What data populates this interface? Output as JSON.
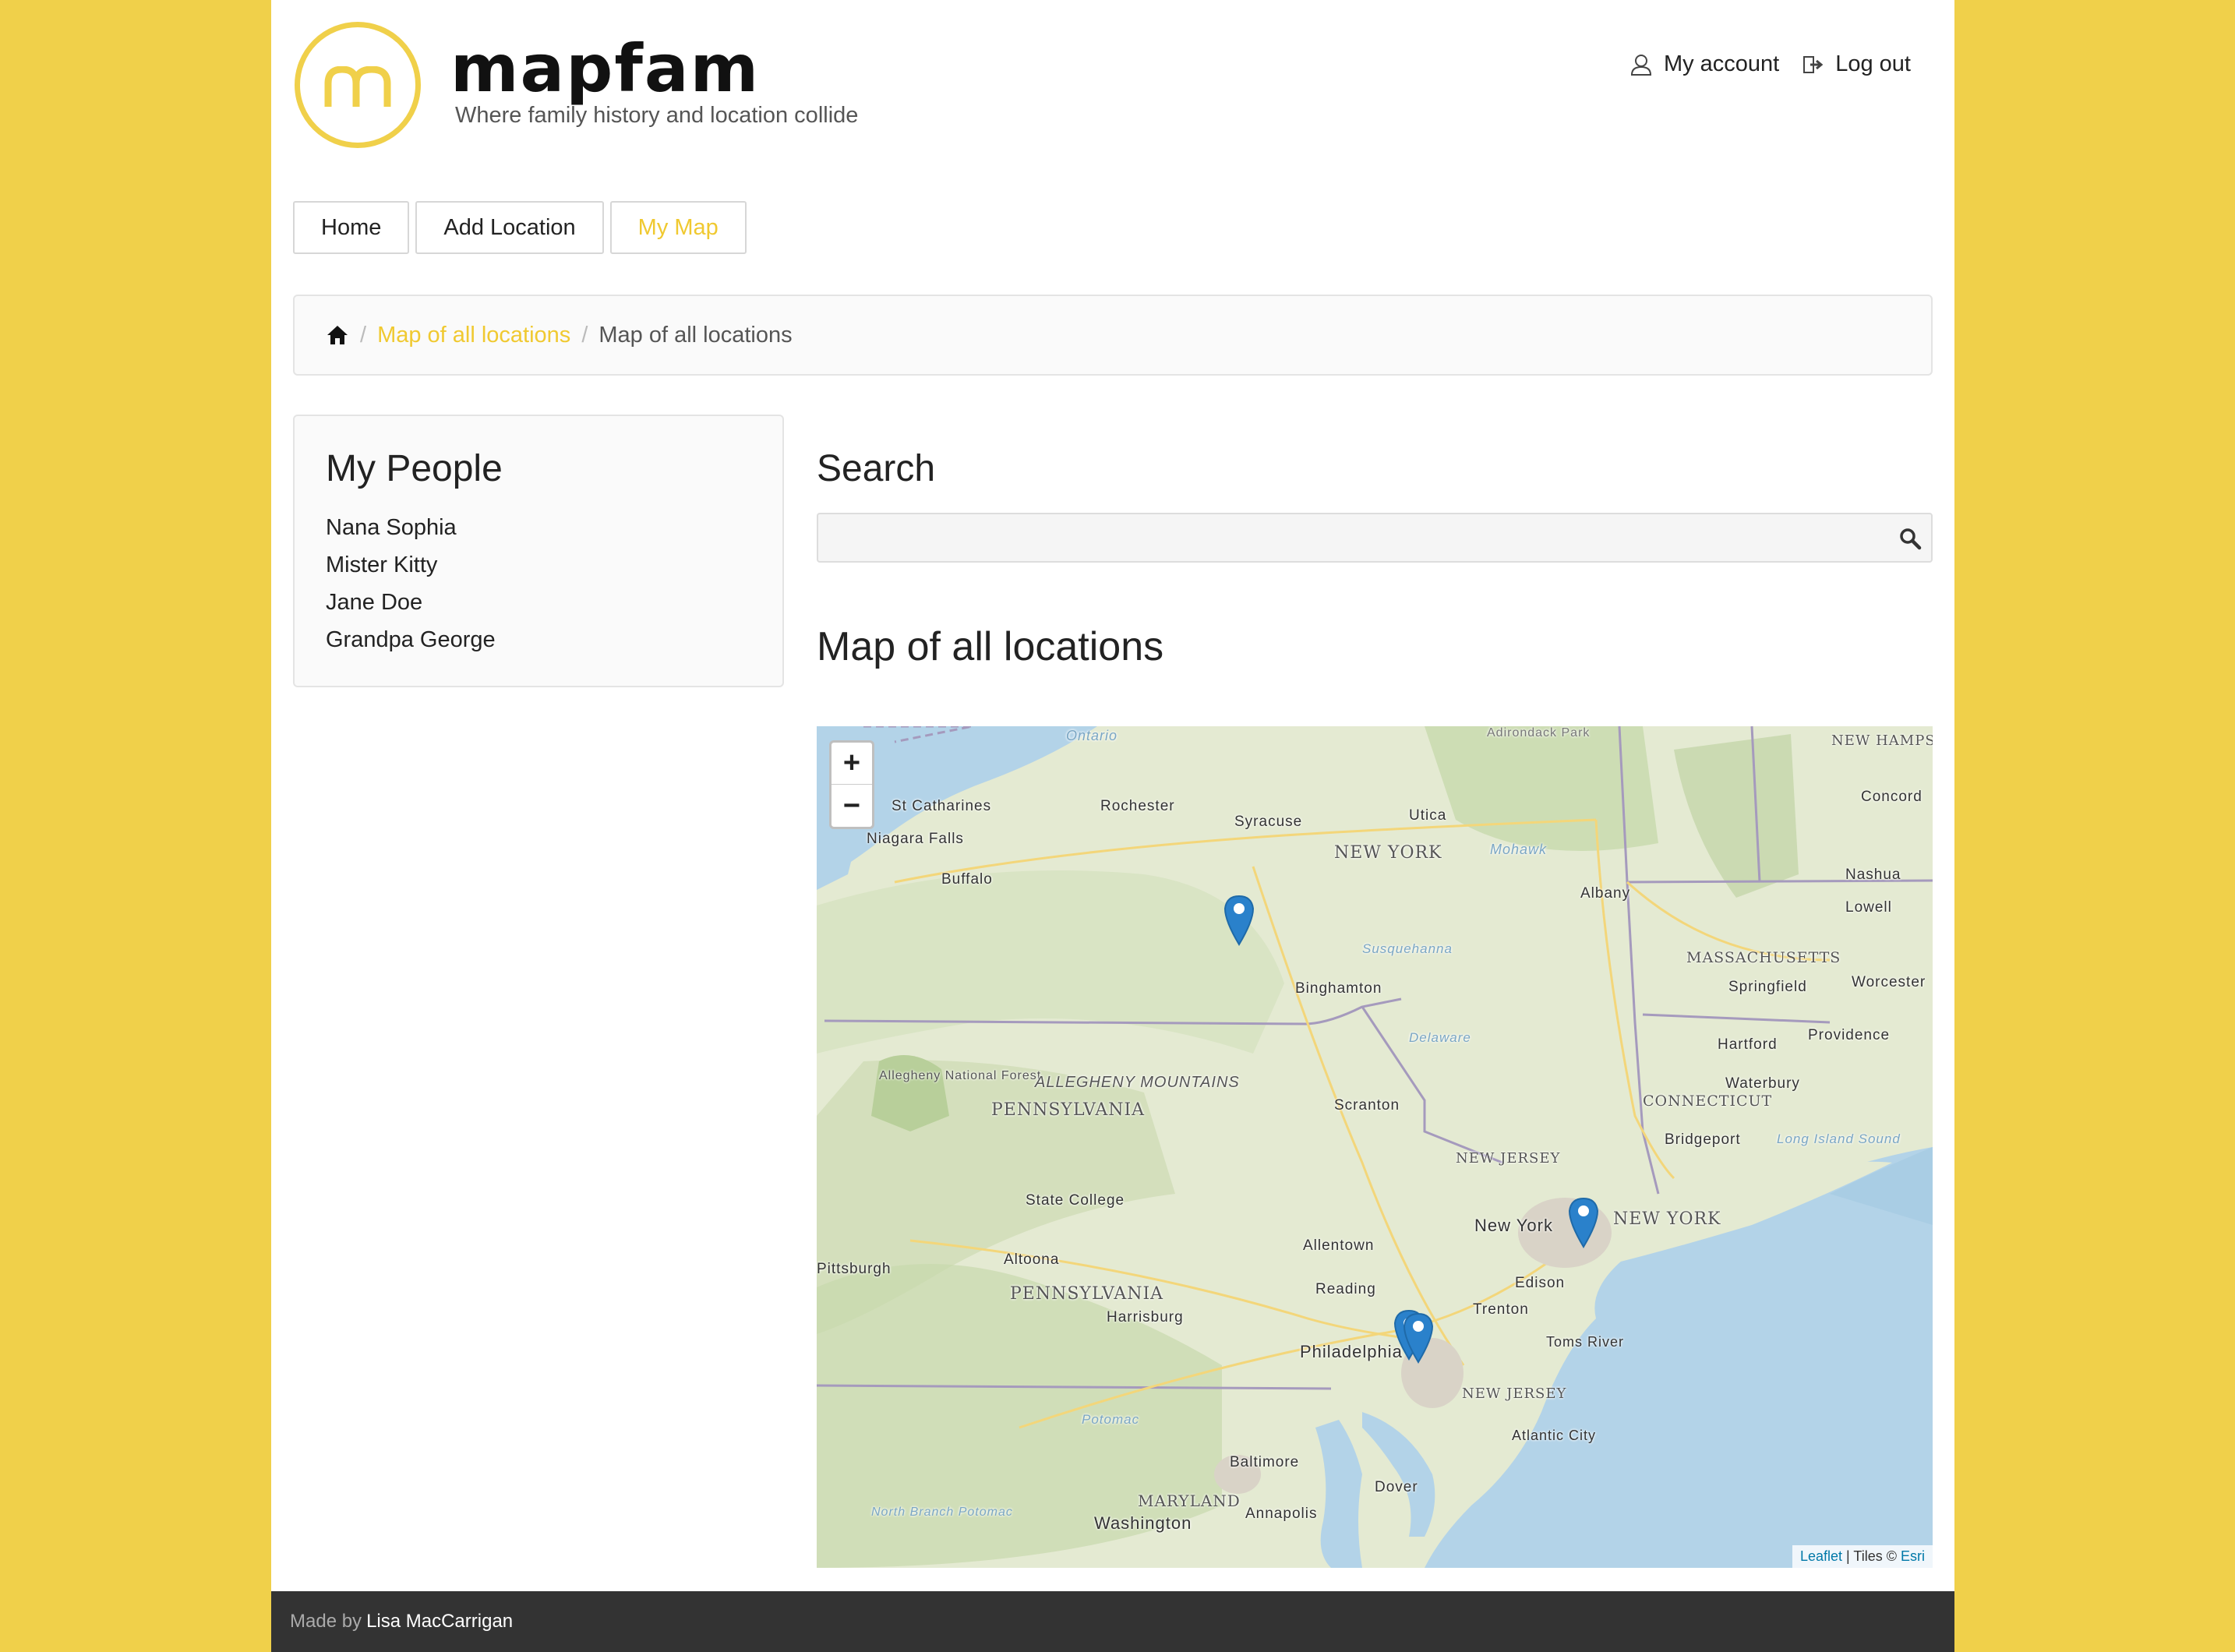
{
  "brand": {
    "name": "mapfam",
    "tagline": "Where family history and location collide",
    "accent": "#f0d04a"
  },
  "account": {
    "my_account": "My account",
    "log_out": "Log out"
  },
  "nav": {
    "home": "Home",
    "add_location": "Add Location",
    "my_map": "My Map",
    "active": "My Map"
  },
  "breadcrumb": {
    "home_icon": "home-icon",
    "link": "Map of all locations",
    "current": "Map of all locations"
  },
  "sidebar": {
    "title": "My People",
    "people": [
      "Nana Sophia",
      "Mister Kitty",
      "Jane Doe",
      "Grandpa George"
    ]
  },
  "search": {
    "title": "Search",
    "value": "",
    "placeholder": ""
  },
  "map": {
    "title": "Map of all locations",
    "zoom_in": "+",
    "zoom_out": "−",
    "attribution_leaflet": "Leaflet",
    "attribution_sep": " | Tiles © ",
    "attribution_esri": "Esri",
    "labels": {
      "ontario": "Ontario",
      "st_catharines": "St Catharines",
      "niagara_falls": "Niagara Falls",
      "buffalo": "Buffalo",
      "rochester": "Rochester",
      "syracuse": "Syracuse",
      "utica": "Utica",
      "new_york_state": "NEW YORK",
      "mohawk": "Mohawk",
      "albany": "Albany",
      "adirondack": "Adirondack Park",
      "new_hampshire": "NEW HAMPSHIRE",
      "concord": "Concord",
      "nashua": "Nashua",
      "lowell": "Lowell",
      "massachusetts": "MASSACHUSETTS",
      "springfield": "Springfield",
      "worcester": "Worcester",
      "providence": "Providence",
      "hartford": "Hartford",
      "waterbury": "Waterbury",
      "connecticut": "CONNECTICUT",
      "bridgeport": "Bridgeport",
      "long_island_sound": "Long Island Sound",
      "binghamton": "Binghamton",
      "susquehanna": "Susquehanna",
      "delaware": "Delaware",
      "allegheny_forest": "Allegheny National Forest",
      "allegheny_mountains": "ALLEGHENY MOUNTAINS",
      "pennsylvania_1": "PENNSYLVANIA",
      "scranton": "Scranton",
      "new_jersey_1": "NEW JERSEY",
      "new_york_city": "New York",
      "new_york_2": "NEW YORK",
      "state_college": "State College",
      "altoona": "Altoona",
      "pittsburgh": "Pittsburgh",
      "pennsylvania_2": "PENNSYLVANIA",
      "harrisburg": "Harrisburg",
      "allentown": "Allentown",
      "reading": "Reading",
      "edison": "Edison",
      "trenton": "Trenton",
      "philadelphia": "Philadelphia",
      "toms_river": "Toms River",
      "new_jersey_2": "NEW JERSEY",
      "atlantic_city": "Atlantic City",
      "baltimore": "Baltimore",
      "maryland": "MARYLAND",
      "annapolis": "Annapolis",
      "dover": "Dover",
      "washington": "Washington",
      "potomac": "Potomac",
      "north_branch": "North Branch Potomac"
    },
    "pin_color": "#2a81cb",
    "pins": [
      "pin-binghamton-area",
      "pin-new-york",
      "pin-philadelphia-1",
      "pin-philadelphia-2"
    ]
  },
  "footer": {
    "prefix": "Made by",
    "author": "Lisa MacCarrigan"
  }
}
